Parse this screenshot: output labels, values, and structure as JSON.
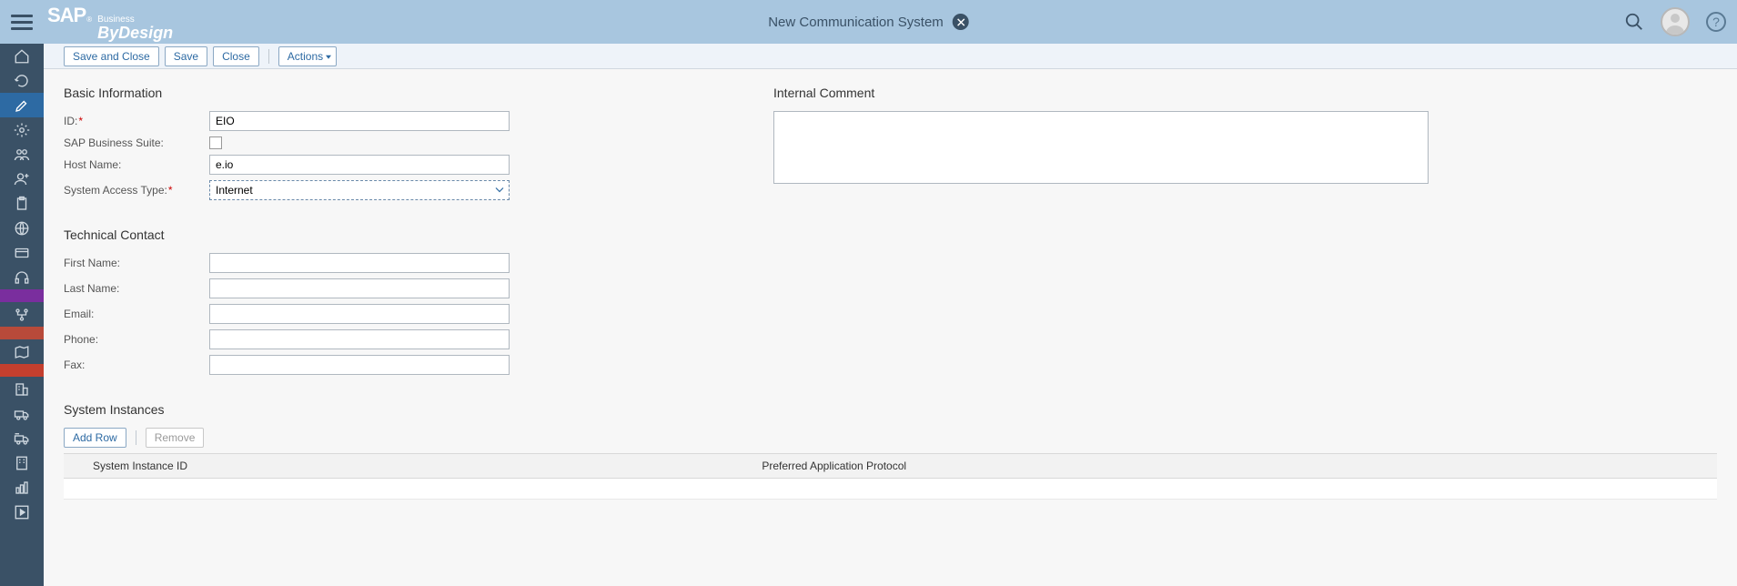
{
  "header": {
    "title": "New Communication System",
    "logo_brand": "SAP",
    "logo_reg": "®",
    "logo_top": "Business",
    "logo_bottom": "ByDesign"
  },
  "toolbar": {
    "save_and_close": "Save and Close",
    "save": "Save",
    "close": "Close",
    "actions": "Actions"
  },
  "sections": {
    "basic_info": "Basic Information",
    "technical_contact": "Technical Contact",
    "system_instances": "System Instances",
    "internal_comment": "Internal Comment"
  },
  "form": {
    "id_label": "ID:",
    "id_value": "EIO",
    "sap_suite_label": "SAP Business Suite:",
    "sap_suite_checked": false,
    "host_label": "Host Name:",
    "host_value": "e.io",
    "access_type_label": "System Access Type:",
    "access_type_value": "Internet",
    "first_name_label": "First Name:",
    "first_name_value": "",
    "last_name_label": "Last Name:",
    "last_name_value": "",
    "email_label": "Email:",
    "email_value": "",
    "phone_label": "Phone:",
    "phone_value": "",
    "fax_label": "Fax:",
    "fax_value": "",
    "comment_value": ""
  },
  "instances": {
    "add_row": "Add Row",
    "remove": "Remove",
    "col_id": "System Instance ID",
    "col_protocol": "Preferred Application Protocol"
  }
}
